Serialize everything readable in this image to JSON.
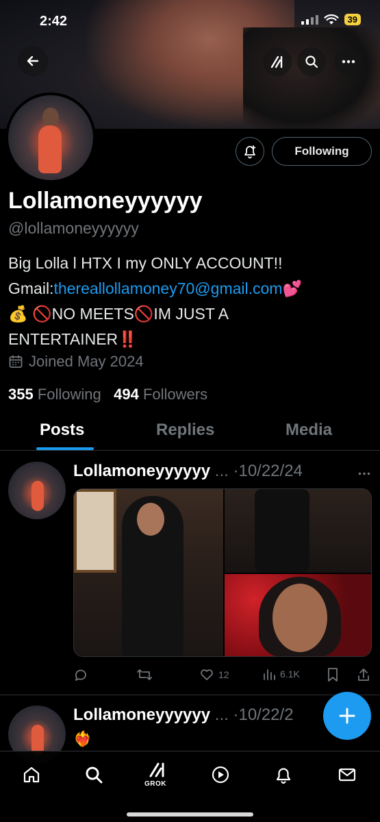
{
  "status": {
    "time": "2:42",
    "battery": "39"
  },
  "profile": {
    "display_name": "Lollamoneyyyyyy",
    "handle": "@lollamoneyyyyyy",
    "bio_line1": "Big Lolla l HTX I my ONLY ACCOUNT!!",
    "bio_gmail_prefix": "Gmail:",
    "bio_email": "thereallollamoney70@gmail.com",
    "bio_emoji1": "💕",
    "bio_line3": "💰 🚫NO MEETS🚫IM JUST A",
    "bio_line4": "ENTERTAINER‼️",
    "joined": "Joined May 2024",
    "following_count": "355",
    "following_label": "Following",
    "followers_count": "494",
    "followers_label": "Followers",
    "follow_button": "Following"
  },
  "tabs": [
    {
      "label": "Posts",
      "active": true
    },
    {
      "label": "Replies",
      "active": false
    },
    {
      "label": "Media",
      "active": false
    }
  ],
  "posts": [
    {
      "name": "Lollamoneyyyyyy",
      "ellipsis": "...",
      "date": "10/22/24",
      "likes": "12",
      "views": "6.1K"
    },
    {
      "name": "Lollamoneyyyyyy",
      "ellipsis": "...",
      "date": "10/22/2",
      "text": "❤️‍🔥"
    }
  ],
  "nav": {
    "grok_label": "GROK"
  },
  "colors": {
    "accent": "#1d9bf0",
    "battery": "#f4d03f"
  }
}
